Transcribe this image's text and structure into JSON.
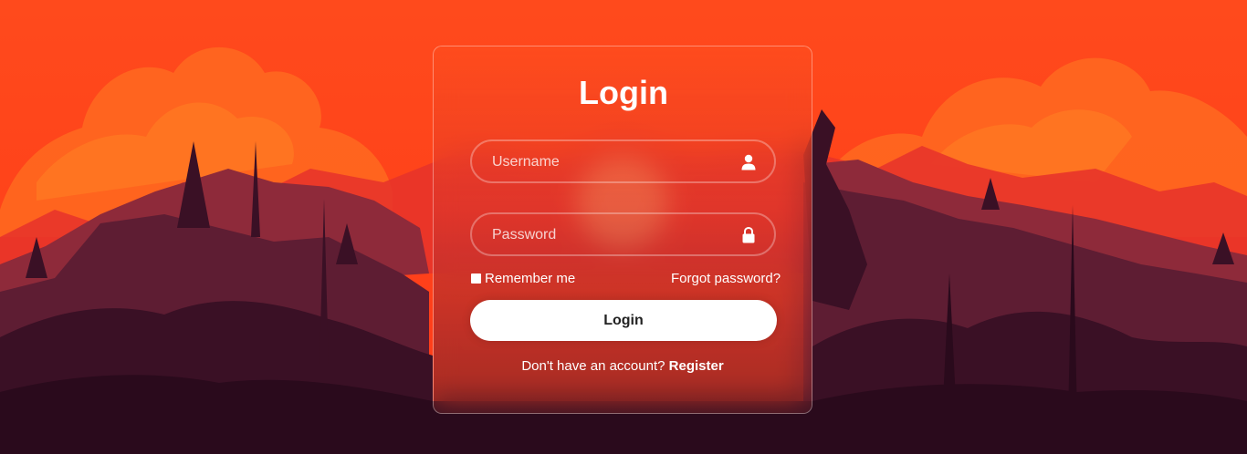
{
  "form": {
    "title": "Login",
    "username": {
      "placeholder": "Username",
      "value": "",
      "icon": "user-icon"
    },
    "password": {
      "placeholder": "Password",
      "value": "",
      "icon": "lock-icon"
    },
    "remember_label": "Remember me",
    "forgot_label": "Forgot password?",
    "submit_label": "Login",
    "register_prompt": "Don't have an account?",
    "register_link": "Register"
  },
  "colors": {
    "sky": "#ff4a1c",
    "cloud": "#ff6a20",
    "button_bg": "#ffffff",
    "text": "#ffffff"
  }
}
